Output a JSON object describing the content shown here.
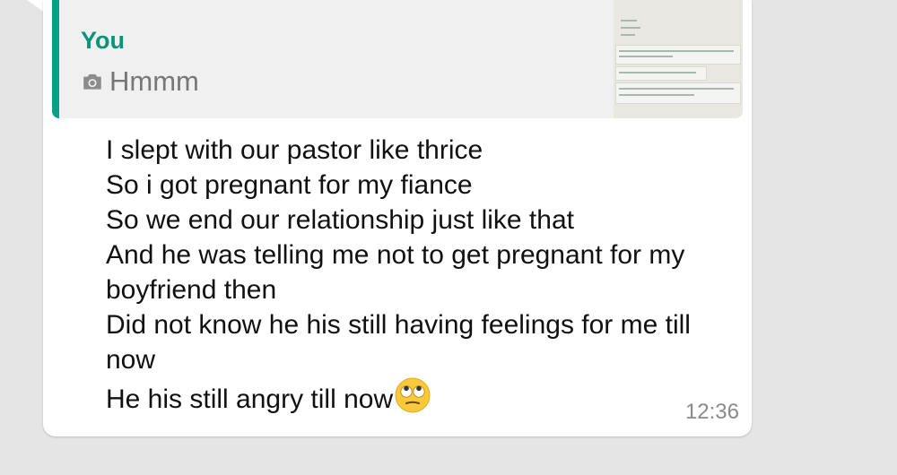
{
  "quoted": {
    "author": "You",
    "icon": "camera-icon",
    "text": "Hmmm",
    "author_color": "#07947a",
    "bar_color": "#06a184"
  },
  "message": {
    "lines": [
      "I slept with our pastor like thrice",
      "So i got pregnant for my fiance",
      "So we end our relationship just like that",
      "And he was telling me not to get pregnant for my",
      "boyfriend then",
      "Did not know he his still having feelings for me till",
      "now"
    ],
    "last_line": "He his still angry till now",
    "emoji": "face-with-rolling-eyes-icon",
    "timestamp": "12:36"
  },
  "colors": {
    "background": "#e5e5e5",
    "bubble": "#ffffff",
    "timestamp": "#8a8a8a"
  }
}
